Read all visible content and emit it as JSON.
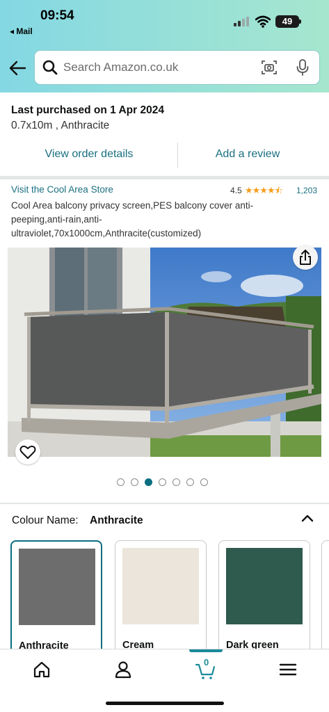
{
  "status_bar": {
    "time": "09:54",
    "back_app": "◂ Mail",
    "battery": "49"
  },
  "search": {
    "placeholder": "Search Amazon.co.uk"
  },
  "purchase": {
    "title": "Last purchased on 1 Apr 2024",
    "variant": "0.7x10m , Anthracite",
    "view_order_label": "View order details",
    "add_review_label": "Add a review"
  },
  "product": {
    "store_link": "Visit the Cool Area Store",
    "rating": "4.5",
    "stars": "★★★★⯪",
    "rating_count": "1,203",
    "title": "Cool Area balcony privacy screen,PES balcony cover anti-peeping,anti-rain,anti-ultraviolet,70x1000cm,Anthracite(customized)",
    "image_count": 7,
    "active_image_index": 2
  },
  "colour": {
    "label": "Colour Name:",
    "selected": "Anthracite",
    "options": [
      {
        "label": "Anthracite",
        "color": "#6d6d6d"
      },
      {
        "label": "Cream",
        "color": "#ebe5db"
      },
      {
        "label": "Dark green",
        "color": "#2f5a4e"
      }
    ]
  },
  "bottom_nav": {
    "cart_count": "0",
    "active": "cart"
  }
}
